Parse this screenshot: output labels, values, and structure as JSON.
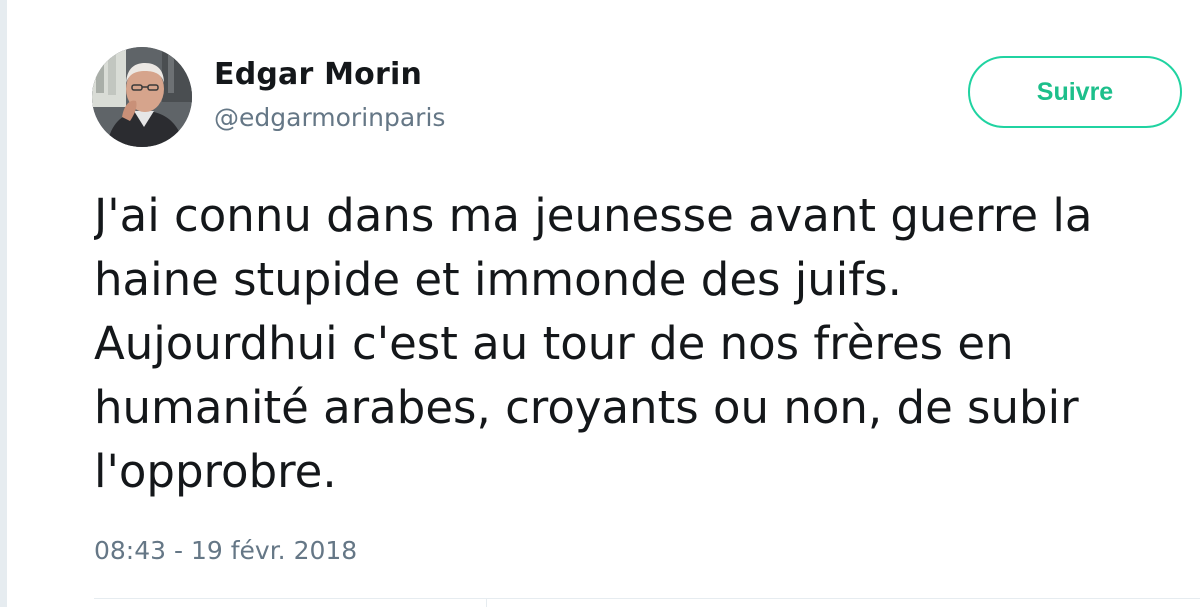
{
  "author": {
    "name": "Edgar Morin",
    "handle": "@edgarmorinparis"
  },
  "follow_button": {
    "label": "Suivre"
  },
  "tweet": {
    "lines": [
      "J'ai connu dans ma jeunesse avant guerre la",
      "haine stupide et immonde des juifs.",
      "Aujourdhui c'est au tour de nos frères en",
      "humanité arabes, croyants ou non, de subir",
      "l'opprobre."
    ],
    "timestamp": "08:43 - 19 févr. 2018"
  },
  "colors": {
    "accent": "#20d3a1",
    "text_primary": "#14171a",
    "text_secondary": "#657786",
    "border": "#e6ecf0"
  }
}
